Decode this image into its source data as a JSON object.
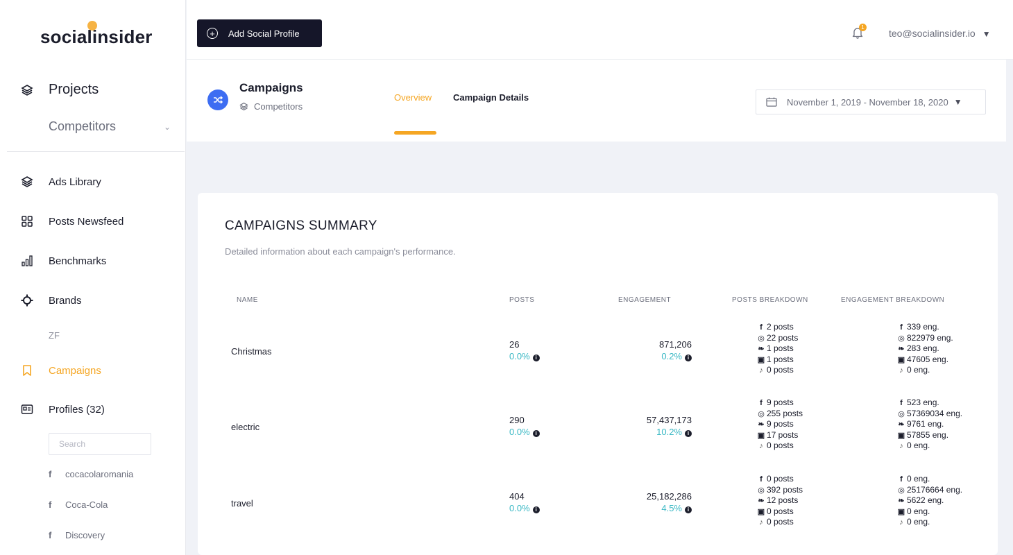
{
  "brand": {
    "logo_text": "socialinsider"
  },
  "sidebar": {
    "projects_label": "Projects",
    "project_selected": "Competitors",
    "nav": [
      {
        "label": "Ads Library",
        "icon": "layers-icon"
      },
      {
        "label": "Posts Newsfeed",
        "icon": "grid-icon"
      },
      {
        "label": "Benchmarks",
        "icon": "bar-chart-icon"
      },
      {
        "label": "Brands",
        "icon": "crosshair-icon"
      },
      {
        "label": "Campaigns",
        "icon": "bookmark-icon"
      },
      {
        "label": "Profiles (32)",
        "icon": "id-card-icon"
      }
    ],
    "brands_sub": "ZF",
    "search_placeholder": "Search",
    "profiles": [
      {
        "network": "f",
        "name": "cocacolaromania"
      },
      {
        "network": "f",
        "name": "Coca-Cola"
      },
      {
        "network": "f",
        "name": "Discovery"
      }
    ]
  },
  "topbar": {
    "add_profile_label": "Add Social Profile",
    "notification_count": "1",
    "user_email": "teo@socialinsider.io"
  },
  "header": {
    "title": "Campaigns",
    "subtitle": "Competitors",
    "tabs": [
      {
        "label": "Overview",
        "active": true
      },
      {
        "label": "Campaign Details",
        "active": false
      }
    ],
    "date_range": "November 1, 2019 - November 18, 2020"
  },
  "summary": {
    "title": "CAMPAIGNS SUMMARY",
    "description": "Detailed information about each campaign's performance.",
    "columns": [
      "NAME",
      "POSTS",
      "ENGAGEMENT",
      "POSTS BREAKDOWN",
      "ENGAGEMENT BREAKDOWN"
    ],
    "rows": [
      {
        "name": "Christmas",
        "posts": "26",
        "posts_pct": "0.0%",
        "engagement": "871,206",
        "engagement_pct": "0.2%",
        "posts_breakdown": [
          "2 posts",
          "22 posts",
          "1 posts",
          "1 posts",
          "0 posts"
        ],
        "engagement_breakdown": [
          "339 eng.",
          "822979 eng.",
          "283 eng.",
          "47605 eng.",
          "0 eng."
        ]
      },
      {
        "name": "electric",
        "posts": "290",
        "posts_pct": "0.0%",
        "engagement": "57,437,173",
        "engagement_pct": "10.2%",
        "posts_breakdown": [
          "9 posts",
          "255 posts",
          "9 posts",
          "17 posts",
          "0 posts"
        ],
        "engagement_breakdown": [
          "523 eng.",
          "57369034 eng.",
          "9761 eng.",
          "57855 eng.",
          "0 eng."
        ]
      },
      {
        "name": "travel",
        "posts": "404",
        "posts_pct": "0.0%",
        "engagement": "25,182,286",
        "engagement_pct": "4.5%",
        "posts_breakdown": [
          "0 posts",
          "392 posts",
          "12 posts",
          "0 posts",
          "0 posts"
        ],
        "engagement_breakdown": [
          "0 eng.",
          "25176664 eng.",
          "5622 eng.",
          "0 eng.",
          "0 eng."
        ]
      }
    ]
  },
  "colors": {
    "accent": "#f5a623",
    "dark": "#151629",
    "teal": "#39b8c4",
    "blue": "#3d6df2"
  }
}
